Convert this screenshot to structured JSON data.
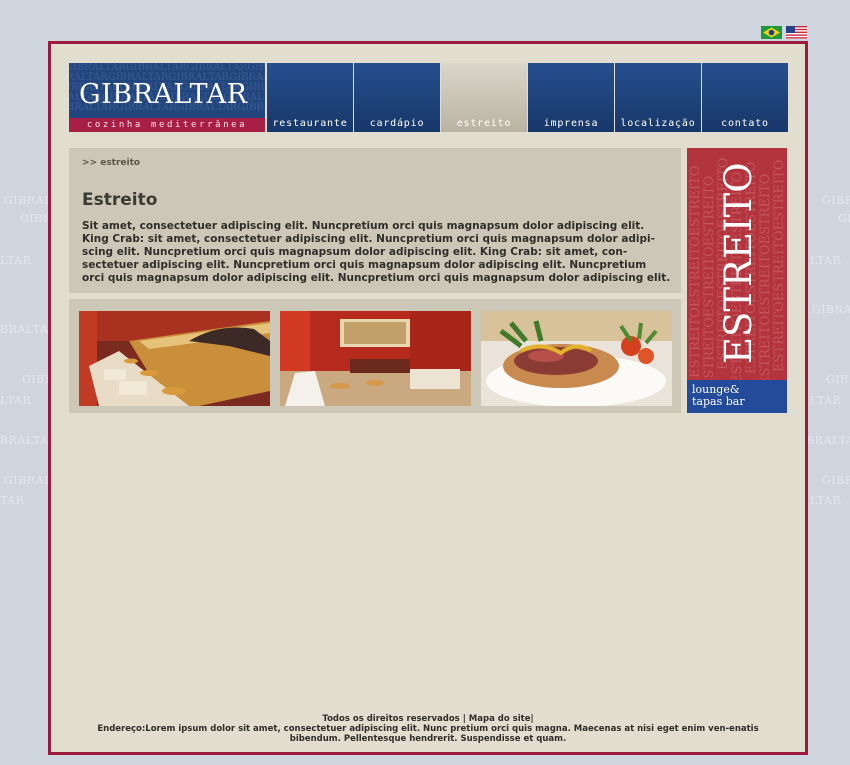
{
  "watermark": {
    "left_words": [
      "GIBRAL",
      "GIBRAL",
      "LTAR",
      "BRALTA",
      "GIBRAL",
      "LTAR",
      "BRALTAR",
      "GIBRAL",
      "TAR"
    ],
    "right_words": [
      "GIBR",
      "GIB",
      "LTAR",
      "GIBRA",
      "GIB",
      "LTAR",
      "BRALTAR",
      "GIBR",
      "LTAR"
    ]
  },
  "flags": [
    "brazil-flag",
    "usa-flag"
  ],
  "logo": {
    "name": "GIBRALTAR",
    "subtitle": "cozinha mediterrânea",
    "pattern_text": "GIBRALTARGIBRALTARGIBRALTARGIBRALTAR"
  },
  "nav": {
    "items": [
      {
        "label": "restaurante"
      },
      {
        "label": "cardápio"
      },
      {
        "label": "estreito"
      },
      {
        "label": "imprensa"
      },
      {
        "label": "localização"
      },
      {
        "label": "contato"
      }
    ],
    "active": "estreito"
  },
  "content": {
    "breadcrumb": ">> estreito",
    "title": "Estreito",
    "body": "Sit amet, consectetuer adipiscing elit. Nuncpretium orci quis magnapsum dolor adipiscing elit. King Crab: sit amet, consectetuer adipiscing elit. Nuncpretium orci quis magnapsum dolor adipi-scing elit. Nuncpretium orci quis magnapsum dolor adipiscing elit. King Crab: sit amet, con-sectetuer adipiscing elit. Nuncpretium orci quis magnapsum dolor adipiscing elit. Nuncpretium orci quis magnapsum dolor adipiscing elit. Nuncpretium orci quis magnapsum dolor adipiscing elit."
  },
  "gallery": [
    "lounge-photo",
    "bar-interior-photo",
    "tapas-dish-photo"
  ],
  "banner": {
    "word": "ESTREITO",
    "pattern_text": "ESTREITOESTREITOESTREITO",
    "tagline_line1": "lounge&",
    "tagline_line2": "tapas bar"
  },
  "footer": {
    "rights": "Todos os direitos reservados",
    "sitemap": "Mapa do site",
    "address": "Endereço:Lorem ipsum dolor sit amet, consectetuer adipiscing elit. Nunc pretium orci quis magna. Maecenas at nisi eget enim ven-enatis bibendum. Pellentesque hendrerit. Suspendisse et quam."
  },
  "colors": {
    "page_bg": "#ced5de",
    "frame_border": "#9c1b3d",
    "content_bg": "#e1ddcf",
    "nav_blue": "#1f437c",
    "banner_red": "#b3343d",
    "banner_blue": "#234b9a"
  }
}
